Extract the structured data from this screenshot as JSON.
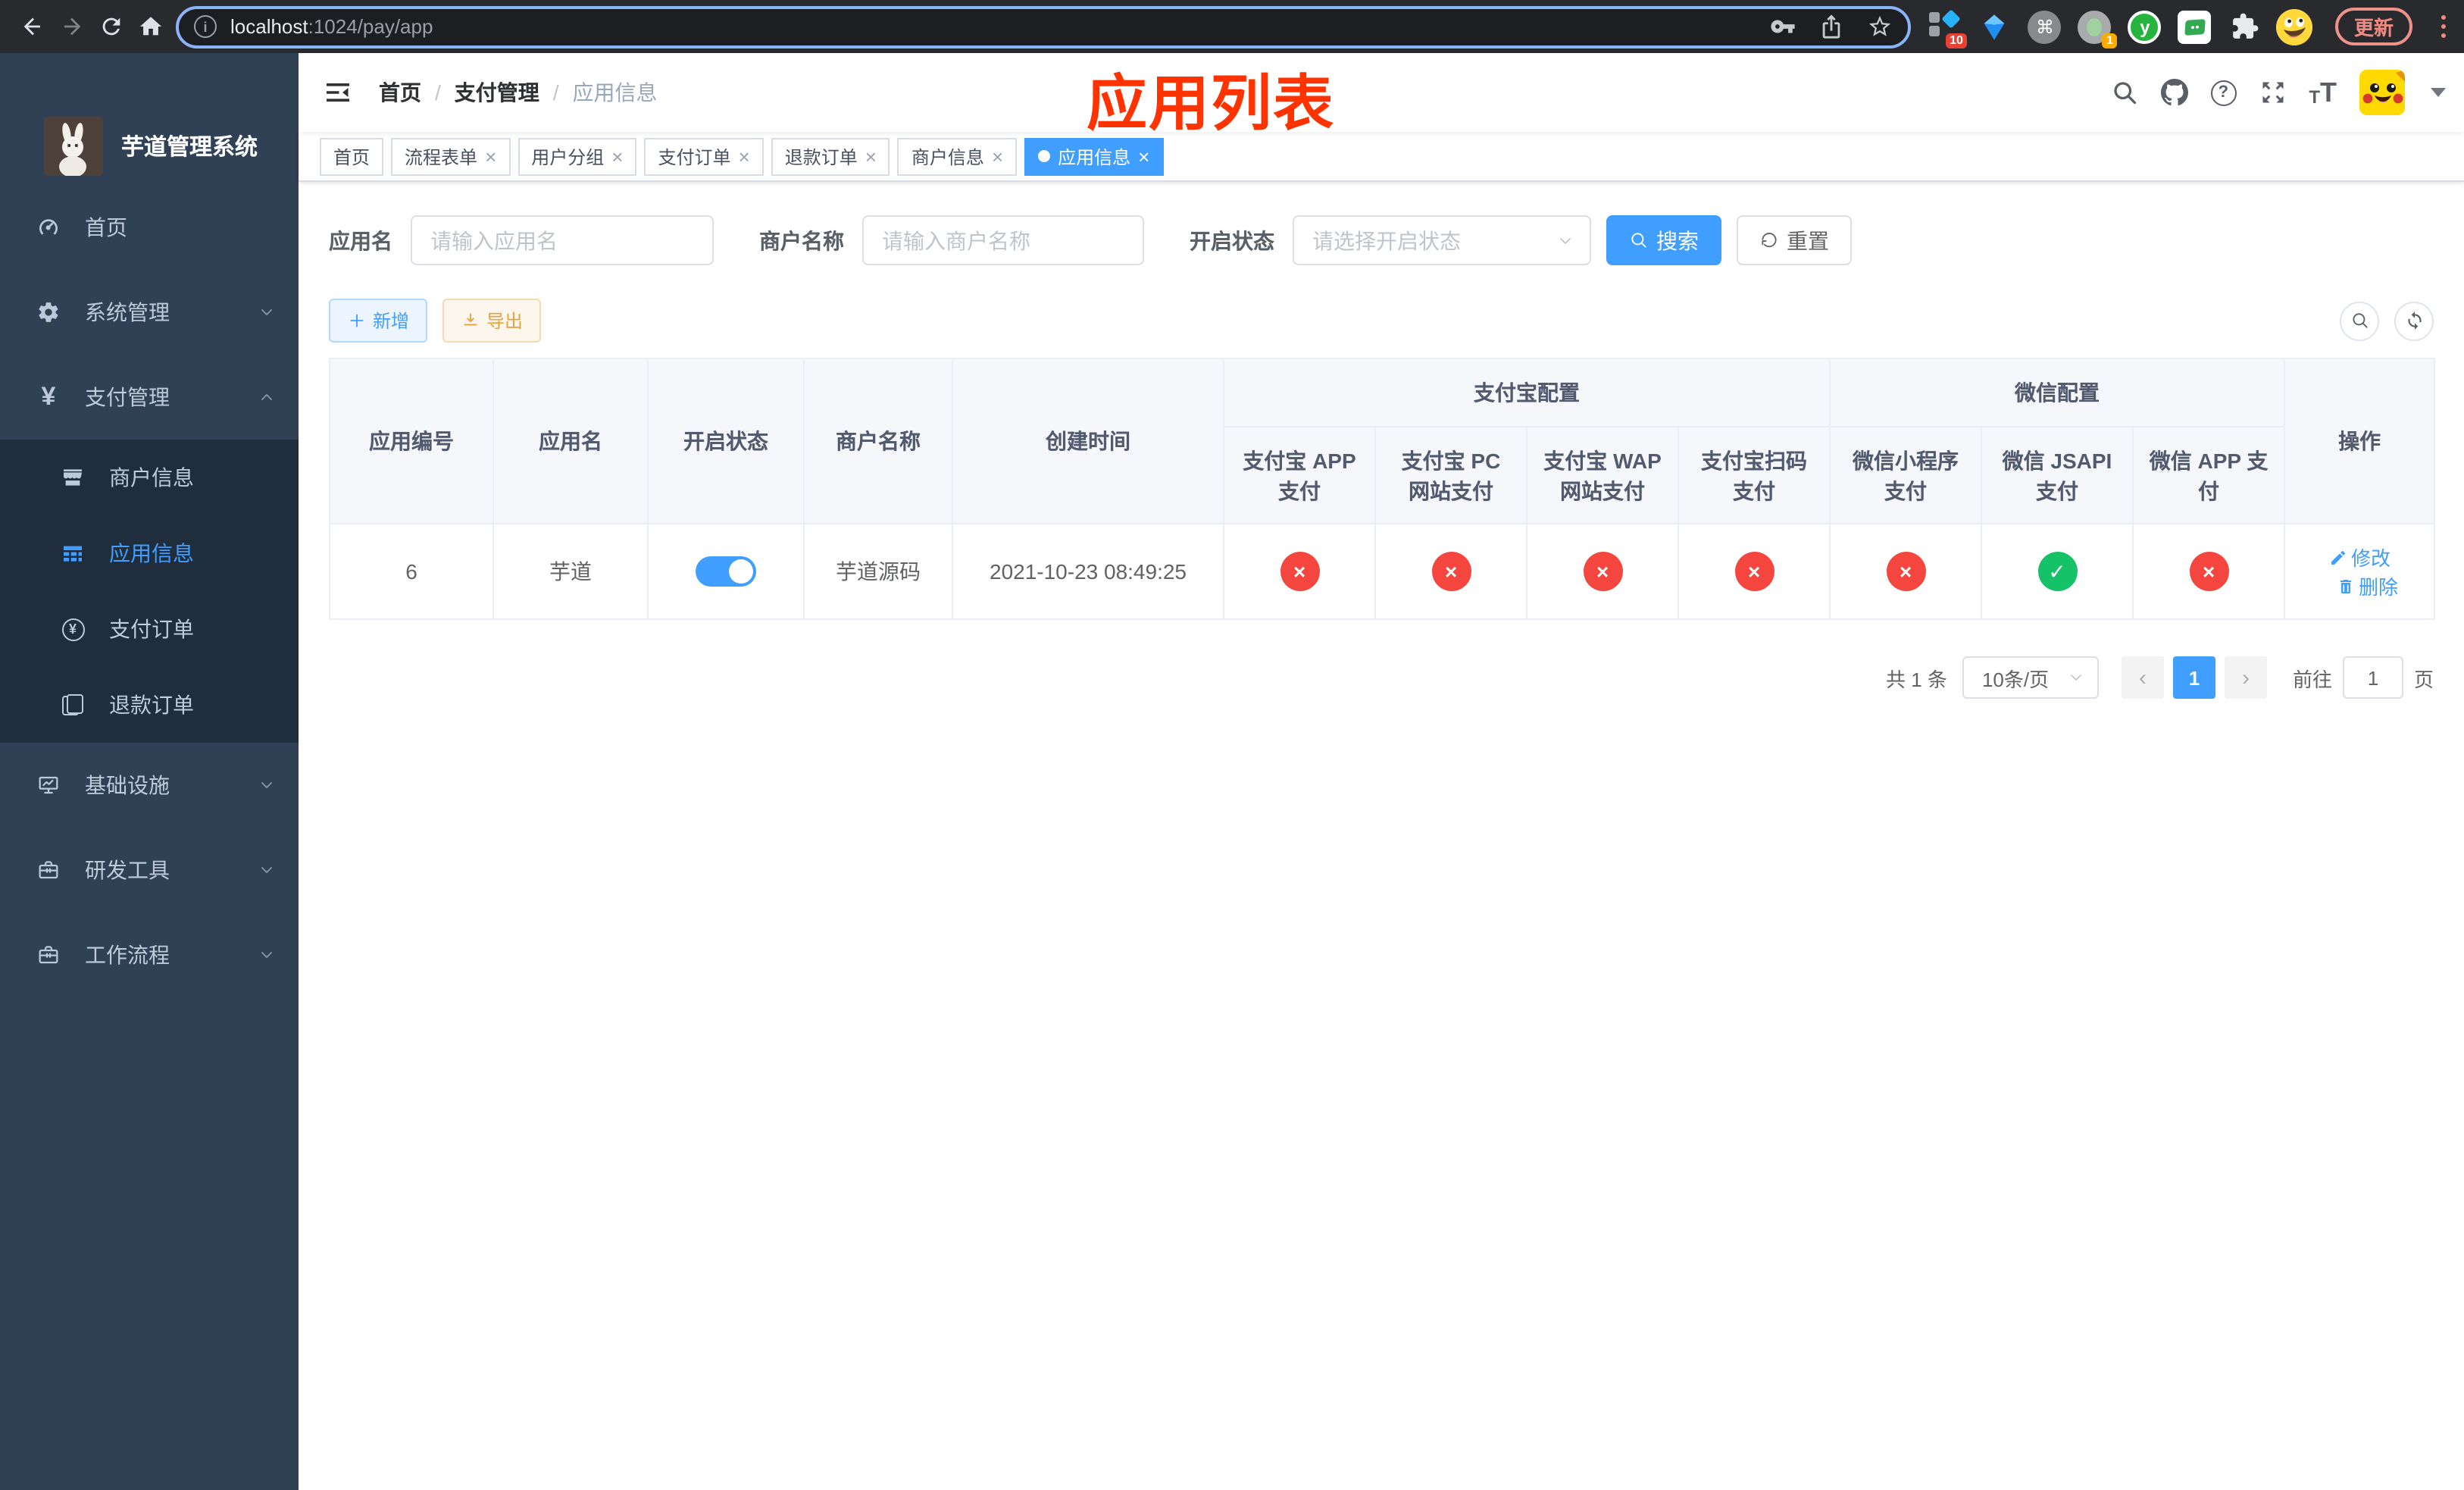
{
  "browser": {
    "url_host": "localhost",
    "url_rest": ":1024/pay/app",
    "update_label": "更新",
    "ext_badge_10": "10",
    "ext_badge_1": "1",
    "ext_y_label": "y"
  },
  "icons": {
    "cmd": "⌘",
    "close": "×",
    "prev": "‹",
    "next": "›",
    "yen": "¥",
    "question": "?",
    "t_small": "T",
    "t_big": "T",
    "breadcrumb_sep": "/",
    "cross": "×",
    "check": "✓",
    "info": "i"
  },
  "sidebar": {
    "title": "芋道管理系统",
    "items": {
      "home": "首页",
      "system": "系统管理",
      "payment": "支付管理",
      "infra": "基础设施",
      "dev": "研发工具",
      "workflow": "工作流程"
    },
    "submenu": {
      "merchant": "商户信息",
      "app": "应用信息",
      "pay_order": "支付订单",
      "refund_order": "退款订单"
    }
  },
  "header": {
    "breadcrumb": [
      "首页",
      "支付管理",
      "应用信息"
    ],
    "annotation": "应用列表"
  },
  "tags": [
    {
      "label": "首页"
    },
    {
      "label": "流程表单"
    },
    {
      "label": "用户分组"
    },
    {
      "label": "支付订单"
    },
    {
      "label": "退款订单"
    },
    {
      "label": "商户信息"
    },
    {
      "label": "应用信息"
    }
  ],
  "search": {
    "app_name_label": "应用名",
    "app_name_placeholder": "请输入应用名",
    "merchant_label": "商户名称",
    "merchant_placeholder": "请输入商户名称",
    "status_label": "开启状态",
    "status_placeholder": "请选择开启状态",
    "search_label": "搜索",
    "reset_label": "重置"
  },
  "toolbar": {
    "add_label": "新增",
    "export_label": "导出"
  },
  "table": {
    "columns": {
      "app_id": "应用编号",
      "app_name": "应用名",
      "status": "开启状态",
      "merchant_name": "商户名称",
      "create_time": "创建时间",
      "alipay_group": "支付宝配置",
      "wechat_group": "微信配置",
      "alipay_app": "支付宝 APP 支付",
      "alipay_pc": "支付宝 PC 网站支付",
      "alipay_wap": "支付宝 WAP 网站支付",
      "alipay_qr": "支付宝扫码支付",
      "wx_lite": "微信小程序支付",
      "wx_jsapi": "微信 JSAPI 支付",
      "wx_app": "微信 APP 支付",
      "actions": "操作"
    },
    "row": {
      "app_id": "6",
      "app_name": "芋道",
      "merchant_name": "芋道源码",
      "create_time": "2021-10-23 08:49:25",
      "edit_label": "修改",
      "delete_label": "删除"
    }
  },
  "pagination": {
    "total": "共 1 条",
    "page_size": "10条/页",
    "current_page": "1",
    "goto_label": "前往",
    "goto_value": "1",
    "page_unit": "页"
  }
}
